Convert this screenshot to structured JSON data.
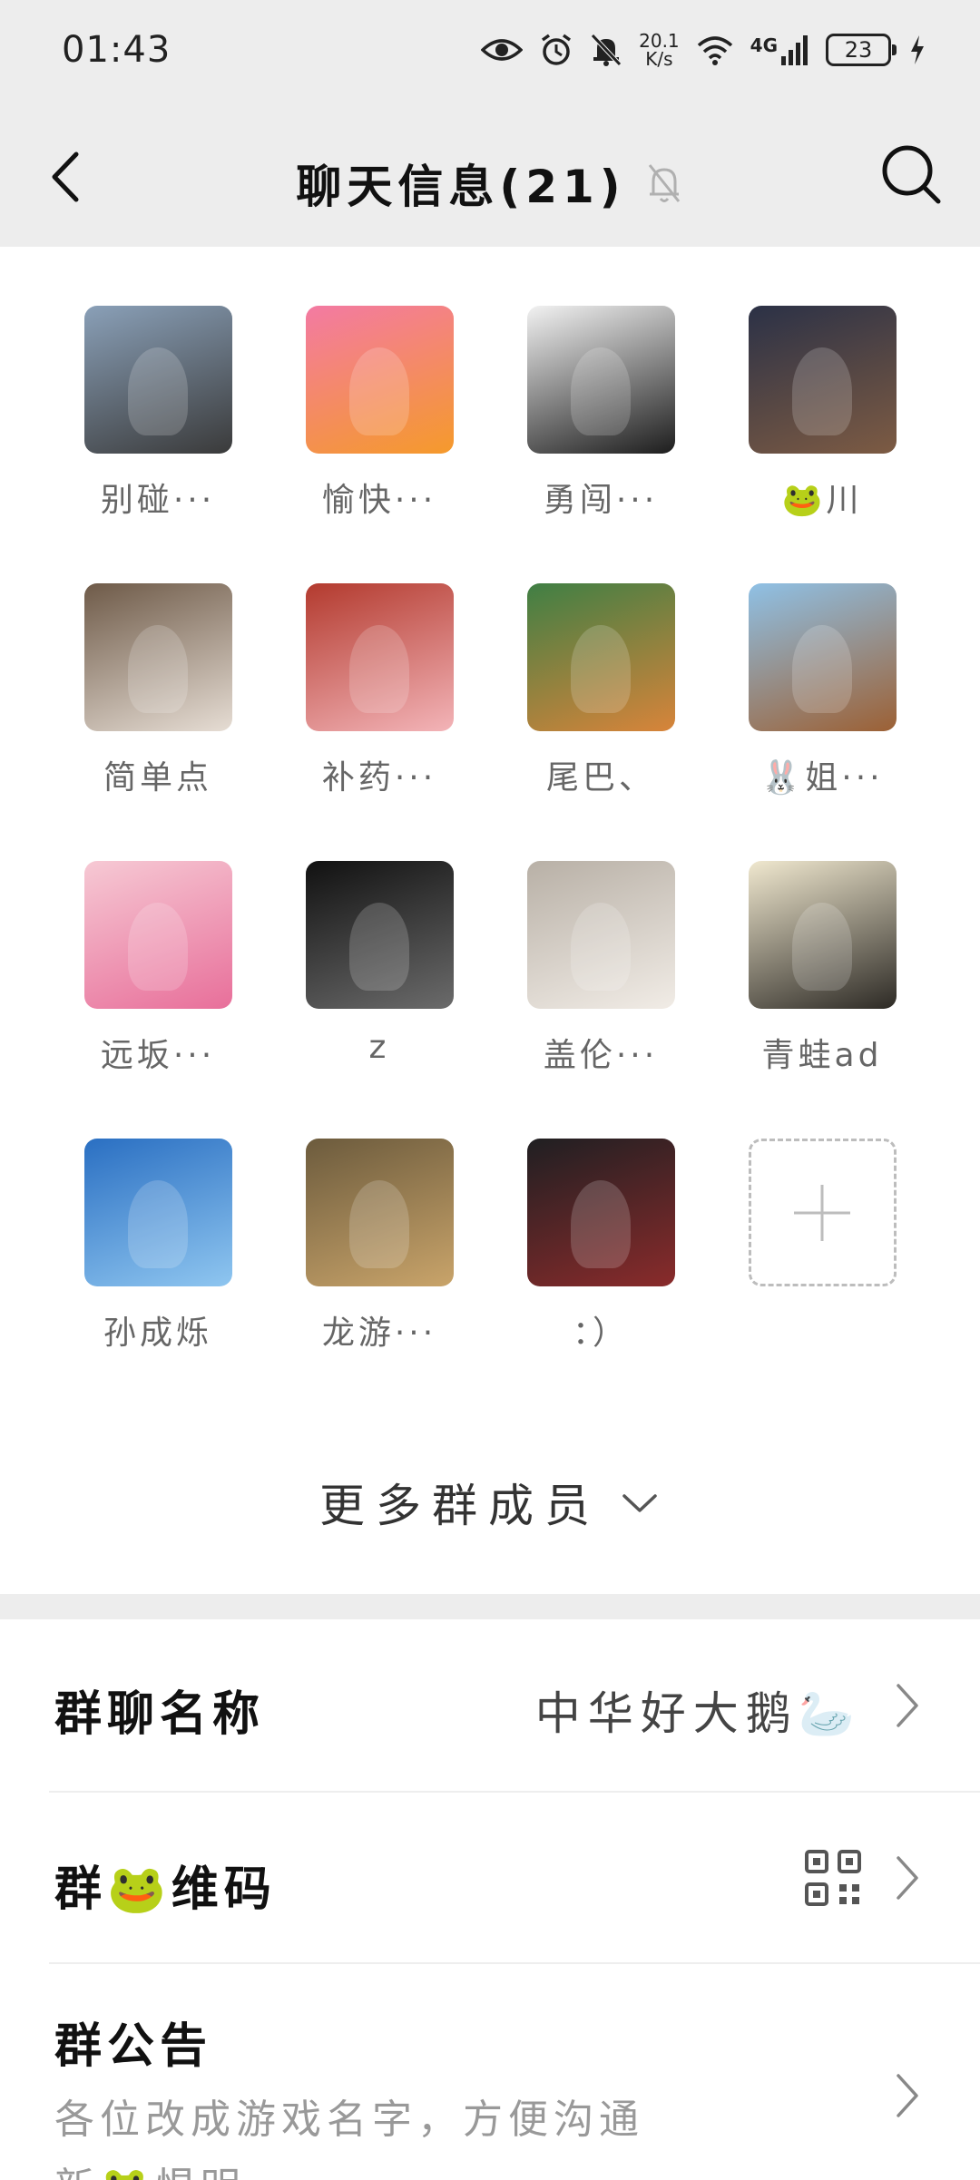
{
  "status_bar": {
    "time": "01:43",
    "net_speed_value": "20.1",
    "net_speed_unit": "K/s",
    "network_label": "4G",
    "battery": "23"
  },
  "header": {
    "title": "聊天信息(21)"
  },
  "members": [
    {
      "name": "别碰···",
      "colors": [
        "#8aa0b8",
        "#3a3a3a"
      ]
    },
    {
      "name": "愉快···",
      "colors": [
        "#f37aa3",
        "#f59a2b"
      ]
    },
    {
      "name": "勇闯···",
      "colors": [
        "#f2f2f2",
        "#1d1d1d"
      ]
    },
    {
      "name": "🐸川",
      "colors": [
        "#2b3146",
        "#7d5b43"
      ]
    },
    {
      "name": "简单点",
      "colors": [
        "#6e5a48",
        "#e6ddd4"
      ]
    },
    {
      "name": "补药···",
      "colors": [
        "#b33a2e",
        "#f3b4b8"
      ]
    },
    {
      "name": "尾巴、",
      "colors": [
        "#3f7f44",
        "#d8843a"
      ]
    },
    {
      "name": "🐰姐···",
      "colors": [
        "#8fc1e6",
        "#9c6034"
      ]
    },
    {
      "name": "远坂···",
      "colors": [
        "#f6c9d4",
        "#e86f9a"
      ]
    },
    {
      "name": "z",
      "colors": [
        "#111111",
        "#6b6b6b"
      ]
    },
    {
      "name": "盖伦···",
      "colors": [
        "#b8b0a6",
        "#f1ece6"
      ]
    },
    {
      "name": "青蛙ad",
      "colors": [
        "#f0e8cf",
        "#2d2a25"
      ]
    },
    {
      "name": "孙成烁",
      "colors": [
        "#2a6fc2",
        "#8fc6f0"
      ]
    },
    {
      "name": "龙游···",
      "colors": [
        "#6c5b3d",
        "#c9a46a"
      ]
    },
    {
      "name": "：）",
      "colors": [
        "#1f1f22",
        "#8a2b2b"
      ]
    }
  ],
  "more_members_label": "更多群成员",
  "settings": {
    "group_name_label": "群聊名称",
    "group_name_value": "中华好大鹅🦢",
    "qr_label": "群🐸维码",
    "notice_label": "群公告",
    "notice_text_line1": "各位改成游戏名字，方便沟通",
    "notice_text_line2": "新🐸惧明，..."
  }
}
